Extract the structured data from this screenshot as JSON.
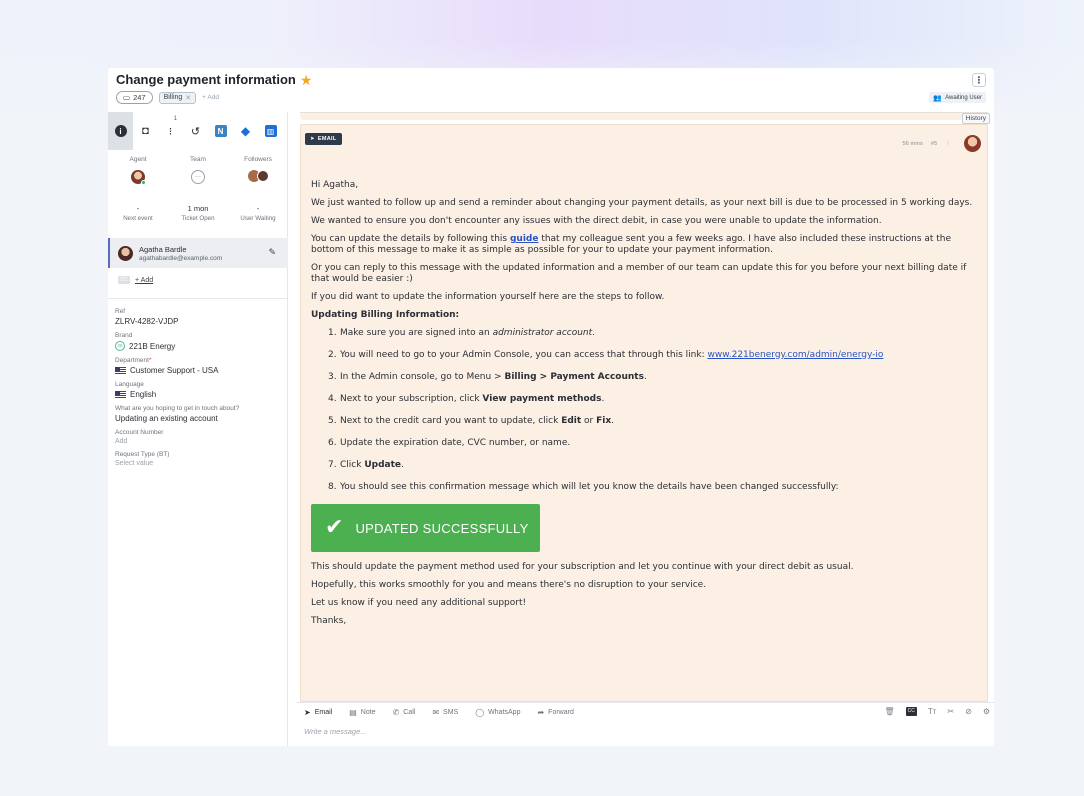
{
  "ticket": {
    "title": "Change payment information",
    "count": "247",
    "tag": "Billing",
    "add_label": "+ Add",
    "status": "Awaiting User",
    "kebab": "⋮"
  },
  "sidebar": {
    "tab_badge": "1",
    "people": {
      "agent_label": "Agent",
      "team_label": "Team",
      "followers_label": "Followers"
    },
    "stats": [
      {
        "value": "-",
        "label": "Next event"
      },
      {
        "value": "1 mon",
        "label": "Ticket Open"
      },
      {
        "value": "-",
        "label": "User Waiting"
      }
    ],
    "requester": {
      "name": "Agatha Bardle",
      "email": "agathabardle@example.com"
    },
    "cc_add": "+ Add",
    "fields": {
      "ref_label": "Ref",
      "ref_value": "ZLRV-4282-VJDP",
      "brand_label": "Brand",
      "brand_badge": "28",
      "brand_value": "221B Energy",
      "department_label": "Department",
      "department_required": "*",
      "department_value": "Customer Support - USA",
      "language_label": "Language",
      "language_value": "English",
      "topic_label": "What are you hoping to get in touch about?",
      "topic_value": "Updating an existing account",
      "account_label": "Account Number",
      "account_value": "Add",
      "request_label": "Request Type (BT)",
      "request_value": "Select value"
    }
  },
  "message": {
    "history_tooltip": "History",
    "channel": "EMAIL",
    "time": "56 mins",
    "number": "#5",
    "greeting": "Hi Agatha,",
    "p1": "We just wanted to follow up and send a reminder about changing your payment details, as your next bill is due to be processed in 5 working days.",
    "p2": "We wanted to ensure you don't encounter any issues with the direct debit, in case you were unable to update the information.",
    "p3_before": "You can update the details by following this ",
    "p3_link": "guide",
    "p3_after": " that my colleague sent you a few weeks ago. I have also included these instructions at the bottom of this message to make it as simple as possible for your to update your payment information.",
    "p4": "Or you can reply to this message with the updated information and a member of our team can update this for you before your next billing date if that would be easier :)",
    "p5": "If you did want to update the information yourself here are the steps to follow.",
    "heading": "Updating Billing Information:",
    "steps": {
      "s1_a": "Make sure you are signed into an ",
      "s1_em": "administrator account",
      "s1_b": ".",
      "s2_a": "You will need to go to your Admin Console, you can access that through this link: ",
      "s2_link": "www.221benergy.com/admin/energy-io",
      "s3_a": "In the Admin console, go to Menu > ",
      "s3_b": "Billing > Payment Accounts",
      "s3_c": ".",
      "s4_a": "Next to your subscription, click ",
      "s4_b": "View payment methods",
      "s4_c": ".",
      "s5_a": "Next to the credit card you want to update, click ",
      "s5_b": "Edit",
      "s5_c": " or ",
      "s5_d": "Fix",
      "s5_e": ".",
      "s6": "Update the expiration date, CVC number, or name.",
      "s7_a": "Click ",
      "s7_b": "Update",
      "s7_c": ".",
      "s8": "You should see this confirmation message which will let you know the details have been changed successfully:"
    },
    "step_numbers": [
      "1.",
      "2.",
      "3.",
      "4.",
      "5.",
      "6.",
      "7.",
      "8."
    ],
    "success_text": "UPDATED SUCCESSFULLY",
    "p6": "This should update the payment method used for your subscription and let you continue with your direct debit as usual.",
    "p7": "Hopefully, this works smoothly for you and means there's no disruption to your service.",
    "p8": "Let us know if you need any additional support!",
    "p9": "Thanks,"
  },
  "compose": {
    "tabs": [
      "Email",
      "Note",
      "Call",
      "SMS",
      "WhatsApp",
      "Forward"
    ],
    "placeholder": "Write a message..."
  },
  "colors": {
    "accent": "#2e3a4a",
    "message_bg": "#fcefe3",
    "success": "#4caf50",
    "link": "#2a55c4"
  },
  "icons": [
    "star-icon",
    "ticket-icon",
    "info-icon",
    "history-icon",
    "jira-icon",
    "gem-icon",
    "trello-icon",
    "pencil-icon",
    "send-icon",
    "note-icon",
    "phone-icon",
    "sms-icon",
    "whatsapp-icon",
    "forward-icon",
    "trash-icon",
    "cc-icon",
    "text-format-icon",
    "scissors-icon",
    "attachment-icon",
    "settings-icon"
  ]
}
